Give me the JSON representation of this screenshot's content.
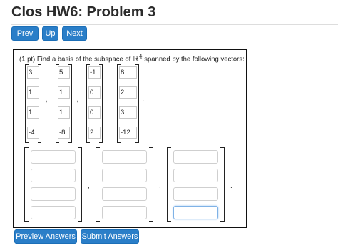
{
  "page": {
    "title": "Clos HW6: Problem 3"
  },
  "nav": {
    "prev_label": "Prev",
    "up_label": "Up",
    "next_label": "Next"
  },
  "problem": {
    "points": "(1 pt)",
    "statement_before": "Find a basis of the subspace of",
    "space_symbol": "ℝ",
    "space_dim": "4",
    "statement_after": "spanned by the following vectors:",
    "vectors": [
      [
        "3",
        "1",
        "1",
        "-4"
      ],
      [
        "5",
        "1",
        "1",
        "-8"
      ],
      [
        "-1",
        "0",
        "0",
        "2"
      ],
      [
        "8",
        "2",
        "3",
        "-12"
      ]
    ],
    "comma": ",",
    "period": "."
  },
  "answer": {
    "vectors": [
      [
        "",
        "",
        "",
        ""
      ],
      [
        "",
        "",
        "",
        ""
      ],
      [
        "",
        "",
        "",
        ""
      ]
    ]
  },
  "actions": {
    "preview_label": "Preview Answers",
    "submit_label": "Submit Answers"
  },
  "colors": {
    "button_bg": "#2a7ec8",
    "button_border": "#1c6fb7",
    "focus_border": "#7fb2e6"
  }
}
